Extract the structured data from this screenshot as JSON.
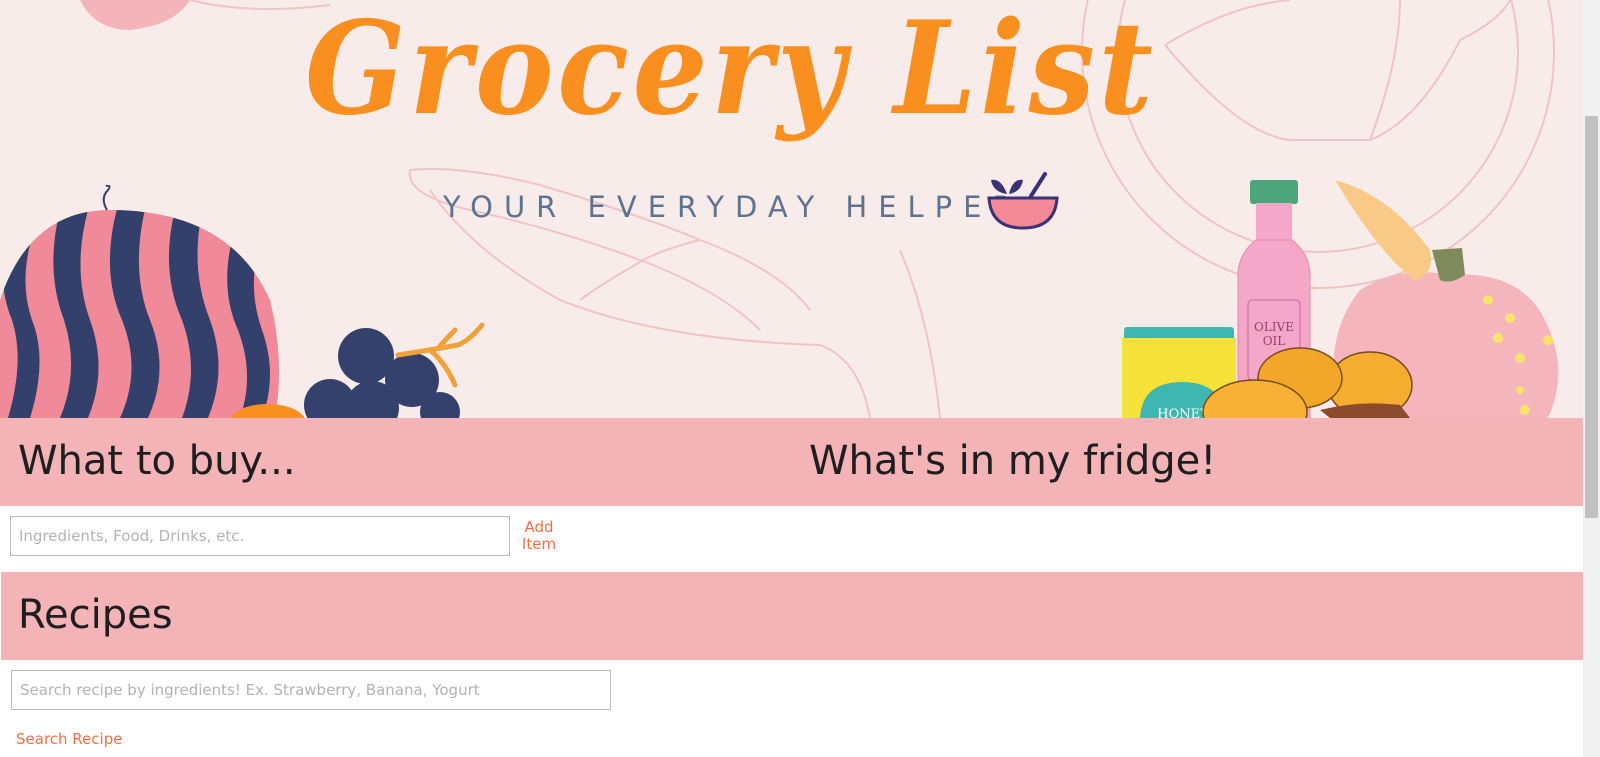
{
  "hero": {
    "title": "Grocery List",
    "tagline": "YOUR EVERYDAY HELPER",
    "icon": "mortar-bowl-icon",
    "jar_label": "HONEY",
    "bottle_label_line1": "OLIVE",
    "bottle_label_line2": "OIL"
  },
  "sections": {
    "buy_heading": "What to buy...",
    "fridge_heading": "What's in my fridge!",
    "recipes_heading": "Recipes"
  },
  "grocery_form": {
    "placeholder": "Ingredients, Food, Drinks, etc.",
    "add_label": "Add Item"
  },
  "recipe_form": {
    "placeholder": "Search recipe by ingredients! Ex. Strawberry, Banana, Yogurt",
    "search_label": "Search Recipe"
  },
  "colors": {
    "title": "#f98f1e",
    "section_bar": "#f3b3b7",
    "link": "#ee6f45",
    "hero_background": "#f7ece9"
  }
}
